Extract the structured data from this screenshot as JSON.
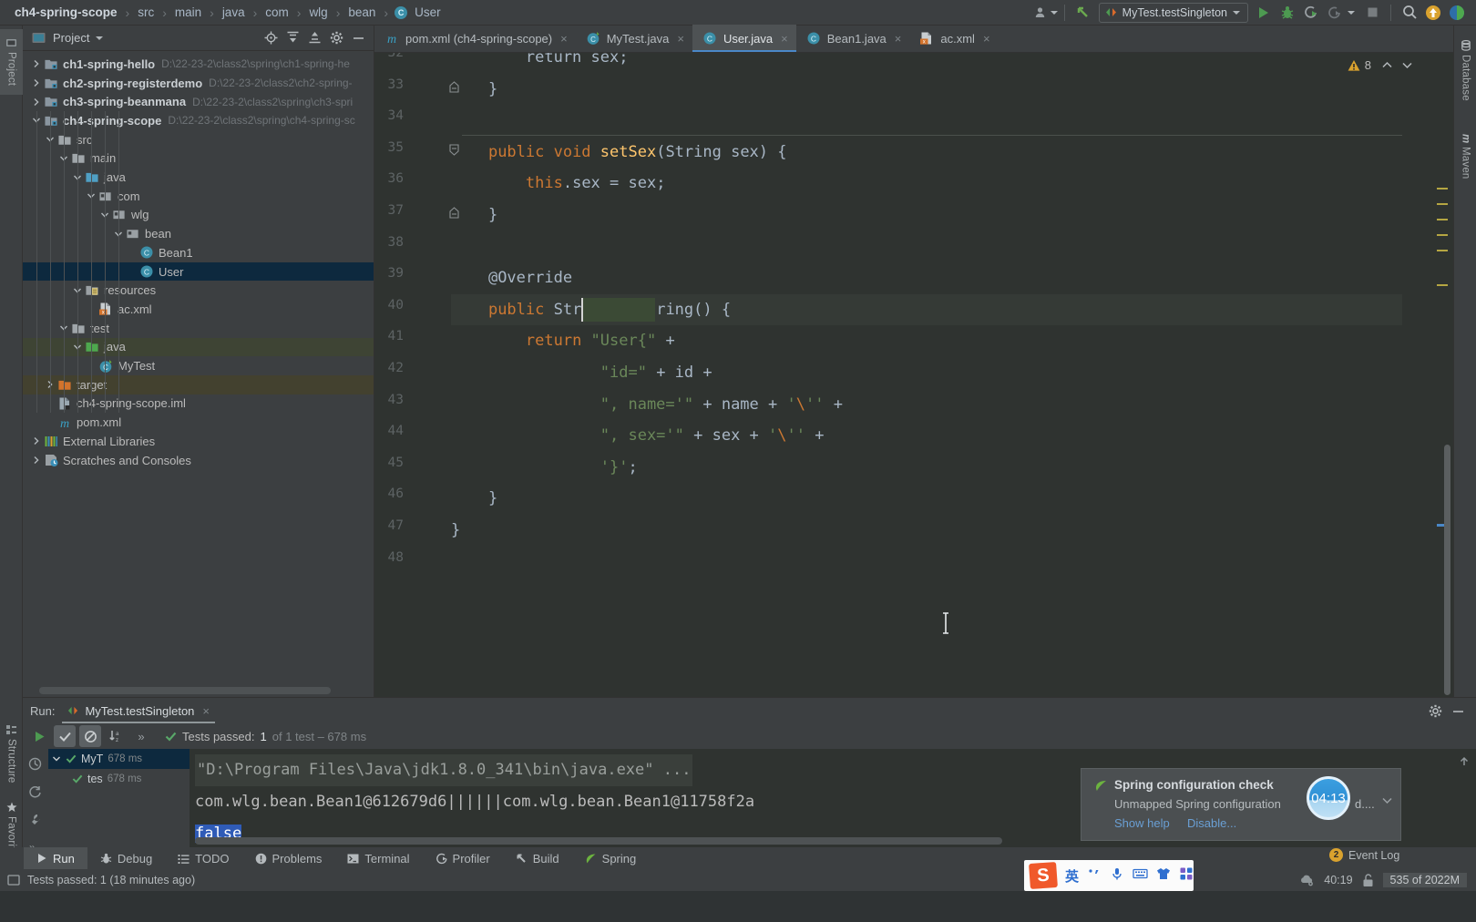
{
  "breadcrumb": {
    "items": [
      {
        "label": "ch4-spring-scope",
        "bold": true
      },
      {
        "label": "src",
        "bold": false
      },
      {
        "label": "main",
        "bold": false
      },
      {
        "label": "java",
        "bold": false
      },
      {
        "label": "com",
        "bold": false
      },
      {
        "label": "wlg",
        "bold": false
      },
      {
        "label": "bean",
        "bold": false
      },
      {
        "label": "User",
        "bold": false,
        "icon": "class-icon"
      }
    ],
    "separator": "›"
  },
  "toolbar": {
    "run_config": "MyTest.testSingleton",
    "icons": [
      "account-icon",
      "back-arrow-icon",
      "run-icon",
      "debug-icon",
      "run-coverage-icon",
      "profile-icon",
      "stop-icon",
      "search-icon",
      "update-icon",
      "ide-icon"
    ]
  },
  "left_strip": {
    "tabs": [
      "Project",
      "Structure",
      "Favorites"
    ]
  },
  "right_strip": {
    "tabs": [
      "Database",
      "Maven"
    ]
  },
  "project_panel": {
    "title": "Project",
    "tool_icons": [
      "locate-icon",
      "collapse-all-icon",
      "expand-icon",
      "gear-icon",
      "minimize-icon"
    ],
    "tree": [
      {
        "depth": 0,
        "twist": "right",
        "icon": "module-icon",
        "label": "ch1-spring-hello",
        "bold": true,
        "path": "D:\\22-23-2\\class2\\spring\\ch1-spring-he",
        "state": "none"
      },
      {
        "depth": 0,
        "twist": "right",
        "icon": "module-icon",
        "label": "ch2-spring-registerdemo",
        "bold": true,
        "path": "D:\\22-23-2\\class2\\ch2-spring-",
        "state": "none"
      },
      {
        "depth": 0,
        "twist": "right",
        "icon": "module-icon",
        "label": "ch3-spring-beanmana",
        "bold": true,
        "path": "D:\\22-23-2\\class2\\spring\\ch3-spri",
        "state": "none"
      },
      {
        "depth": 0,
        "twist": "down",
        "icon": "module-icon",
        "label": "ch4-spring-scope",
        "bold": true,
        "path": "D:\\22-23-2\\class2\\spring\\ch4-spring-sc",
        "state": "none"
      },
      {
        "depth": 1,
        "twist": "down",
        "icon": "folder-icon",
        "label": "src",
        "bold": false,
        "path": "",
        "state": "none"
      },
      {
        "depth": 2,
        "twist": "down",
        "icon": "folder-icon",
        "label": "main",
        "bold": false,
        "path": "",
        "state": "none"
      },
      {
        "depth": 3,
        "twist": "down",
        "icon": "source-folder-icon",
        "label": "java",
        "bold": false,
        "path": "",
        "state": "none"
      },
      {
        "depth": 4,
        "twist": "down",
        "icon": "package-icon",
        "label": "com",
        "bold": false,
        "path": "",
        "state": "none"
      },
      {
        "depth": 5,
        "twist": "down",
        "icon": "package-icon",
        "label": "wlg",
        "bold": false,
        "path": "",
        "state": "none"
      },
      {
        "depth": 6,
        "twist": "down",
        "icon": "package-icon",
        "label": "bean",
        "bold": false,
        "path": "",
        "state": "none"
      },
      {
        "depth": 7,
        "twist": "none",
        "icon": "class-icon",
        "label": "Bean1",
        "bold": false,
        "path": "",
        "state": "none"
      },
      {
        "depth": 7,
        "twist": "none",
        "icon": "class-icon",
        "label": "User",
        "bold": false,
        "path": "",
        "state": "selected"
      },
      {
        "depth": 3,
        "twist": "down",
        "icon": "resource-folder-icon",
        "label": "resources",
        "bold": false,
        "path": "",
        "state": "none"
      },
      {
        "depth": 4,
        "twist": "none",
        "icon": "xml-icon",
        "label": "ac.xml",
        "bold": false,
        "path": "",
        "state": "none"
      },
      {
        "depth": 2,
        "twist": "down",
        "icon": "folder-icon",
        "label": "test",
        "bold": false,
        "path": "",
        "state": "none"
      },
      {
        "depth": 3,
        "twist": "down",
        "icon": "test-folder-icon",
        "label": "java",
        "bold": false,
        "path": "",
        "state": "green"
      },
      {
        "depth": 4,
        "twist": "none",
        "icon": "test-class-icon",
        "label": "MyTest",
        "bold": false,
        "path": "",
        "state": "none"
      },
      {
        "depth": 1,
        "twist": "right",
        "icon": "target-folder-icon",
        "label": "target",
        "bold": false,
        "path": "",
        "state": "target"
      },
      {
        "depth": 1,
        "twist": "none",
        "icon": "iml-icon",
        "label": "ch4-spring-scope.iml",
        "bold": false,
        "path": "",
        "state": "none"
      },
      {
        "depth": 1,
        "twist": "none",
        "icon": "maven-icon",
        "label": "pom.xml",
        "bold": false,
        "path": "",
        "state": "none"
      },
      {
        "depth": 0,
        "twist": "right",
        "icon": "library-icon",
        "label": "External Libraries",
        "bold": false,
        "path": "",
        "state": "none"
      },
      {
        "depth": 0,
        "twist": "right",
        "icon": "scratch-icon",
        "label": "Scratches and Consoles",
        "bold": false,
        "path": "",
        "state": "none"
      }
    ]
  },
  "editor_tabs": [
    {
      "label": "pom.xml (ch4-spring-scope)",
      "icon": "maven-icon",
      "active": false,
      "close": "×"
    },
    {
      "label": "MyTest.java",
      "icon": "test-class-icon",
      "active": false,
      "close": "×"
    },
    {
      "label": "User.java",
      "icon": "class-icon",
      "active": true,
      "close": "×"
    },
    {
      "label": "Bean1.java",
      "icon": "class-icon",
      "active": false,
      "close": "×"
    },
    {
      "label": "ac.xml",
      "icon": "xml-icon",
      "active": false,
      "close": "×"
    }
  ],
  "editor": {
    "warning_count": "8",
    "first_visible_line": 32,
    "caret_line": 40,
    "lines": [
      {
        "n": 32,
        "segments": [
          {
            "t": "        return sex;",
            "c": "txt"
          }
        ],
        "clipped": true
      },
      {
        "n": 33,
        "segments": [
          {
            "t": "    }",
            "c": "txt"
          }
        ],
        "fold": "end"
      },
      {
        "n": 34,
        "segments": [
          {
            "t": "",
            "c": "txt"
          }
        ]
      },
      {
        "n": 35,
        "segments": [
          {
            "t": "    ",
            "c": "txt"
          },
          {
            "t": "public void ",
            "c": "kw"
          },
          {
            "t": "setSex",
            "c": "fn"
          },
          {
            "t": "(String sex) {",
            "c": "txt"
          }
        ],
        "fold": "start"
      },
      {
        "n": 36,
        "segments": [
          {
            "t": "        ",
            "c": "txt"
          },
          {
            "t": "this",
            "c": "kw"
          },
          {
            "t": ".sex = sex;",
            "c": "txt"
          }
        ]
      },
      {
        "n": 37,
        "segments": [
          {
            "t": "    }",
            "c": "txt"
          }
        ],
        "fold": "end"
      },
      {
        "n": 38,
        "segments": [
          {
            "t": "",
            "c": "txt"
          }
        ]
      },
      {
        "n": 39,
        "segments": [
          {
            "t": "    ",
            "c": "txt"
          },
          {
            "t": "@Override",
            "c": "txt"
          }
        ]
      },
      {
        "n": 40,
        "segments": [
          {
            "t": "    ",
            "c": "txt"
          },
          {
            "t": "public ",
            "c": "kw"
          },
          {
            "t": "String ",
            "c": "txt"
          },
          {
            "t": "toString",
            "c": "txt"
          },
          {
            "t": "() {",
            "c": "txt"
          }
        ],
        "highlight": true
      },
      {
        "n": 41,
        "segments": [
          {
            "t": "        ",
            "c": "txt"
          },
          {
            "t": "return ",
            "c": "kw"
          },
          {
            "t": "\"User{\"",
            "c": "str"
          },
          {
            "t": " +",
            "c": "txt"
          }
        ]
      },
      {
        "n": 42,
        "segments": [
          {
            "t": "                ",
            "c": "txt"
          },
          {
            "t": "\"id=\"",
            "c": "str"
          },
          {
            "t": " + id +",
            "c": "txt"
          }
        ]
      },
      {
        "n": 43,
        "segments": [
          {
            "t": "                ",
            "c": "txt"
          },
          {
            "t": "\", name='\"",
            "c": "str"
          },
          {
            "t": " + name + ",
            "c": "txt"
          },
          {
            "t": "'",
            "c": "str"
          },
          {
            "t": "\\",
            "c": "esc"
          },
          {
            "t": "''",
            "c": "str"
          },
          {
            "t": " +",
            "c": "txt"
          }
        ]
      },
      {
        "n": 44,
        "segments": [
          {
            "t": "                ",
            "c": "txt"
          },
          {
            "t": "\", sex='\"",
            "c": "str"
          },
          {
            "t": " + sex + ",
            "c": "txt"
          },
          {
            "t": "'",
            "c": "str"
          },
          {
            "t": "\\",
            "c": "esc"
          },
          {
            "t": "''",
            "c": "str"
          },
          {
            "t": " +",
            "c": "txt"
          }
        ]
      },
      {
        "n": 45,
        "segments": [
          {
            "t": "                ",
            "c": "txt"
          },
          {
            "t": "'}'",
            "c": "str"
          },
          {
            "t": ";",
            "c": "txt"
          }
        ]
      },
      {
        "n": 46,
        "segments": [
          {
            "t": "    }",
            "c": "txt"
          }
        ]
      },
      {
        "n": 47,
        "segments": [
          {
            "t": "}",
            "c": "txt"
          }
        ]
      },
      {
        "n": 48,
        "segments": [
          {
            "t": "",
            "c": "txt"
          }
        ]
      }
    ]
  },
  "run_panel": {
    "run_label": "Run:",
    "tab_label": "MyTest.testSingleton",
    "tab_close": "×",
    "toolbar_icons": [
      "rerun-icon",
      "show-passed-icon",
      "show-ignored-icon",
      "sort-alpha-icon",
      "expand-icon"
    ],
    "test_status_prefix": "Tests passed: ",
    "test_status_count": "1",
    "test_status_suffix": " of 1 test – 678 ms",
    "tests": [
      {
        "name": "MyT",
        "ms": "678 ms",
        "selected": true,
        "depth": 0
      },
      {
        "name": "tes",
        "ms": "678 ms",
        "selected": false,
        "depth": 1
      }
    ],
    "console": [
      {
        "text": "\"D:\\Program Files\\Java\\jdk1.8.0_341\\bin\\java.exe\" ...",
        "style": "cmd"
      },
      {
        "text": "com.wlg.bean.Bean1@612679d6||||||com.wlg.bean.Bean1@11758f2a",
        "style": "plain"
      },
      {
        "text": "false",
        "style": "selected"
      }
    ]
  },
  "balloon": {
    "icon": "spring-leaf-icon",
    "title": "Spring configuration check",
    "body": "Unmapped Spring configuration",
    "body_tail": "d....",
    "timer": "04:13",
    "links": [
      "Show help",
      "Disable..."
    ]
  },
  "bottom_tabs": [
    {
      "label": "Run",
      "icon": "run-icon",
      "selected": true
    },
    {
      "label": "Debug",
      "icon": "debug-icon",
      "selected": false
    },
    {
      "label": "TODO",
      "icon": "todo-icon",
      "selected": false
    },
    {
      "label": "Problems",
      "icon": "problems-icon",
      "selected": false
    },
    {
      "label": "Terminal",
      "icon": "terminal-icon",
      "selected": false
    },
    {
      "label": "Profiler",
      "icon": "profiler-icon",
      "selected": false
    },
    {
      "label": "Build",
      "icon": "build-icon",
      "selected": false
    },
    {
      "label": "Spring",
      "icon": "spring-leaf-icon",
      "selected": false
    }
  ],
  "event_log": {
    "count": "2",
    "label": "Event Log"
  },
  "status_bar": {
    "message": "Tests passed: 1 (18 minutes ago)",
    "timer": "40:19",
    "memory": "535 of 2022M"
  },
  "ime": {
    "logo": "S",
    "mode": "英",
    "icons": [
      "punctuation-icon",
      "mic-icon",
      "keyboard-icon",
      "skin-icon",
      "apps-icon"
    ]
  },
  "colors": {
    "ide_bg": "#3c3f41",
    "editor_bg": "#2f3330",
    "accent_blue": "#4a88c7",
    "selection_blue": "#0d293e",
    "keyword_orange": "#cc7832",
    "string_green": "#6a8759",
    "method_yellow": "#ffc66d",
    "green_run": "#59a869"
  }
}
